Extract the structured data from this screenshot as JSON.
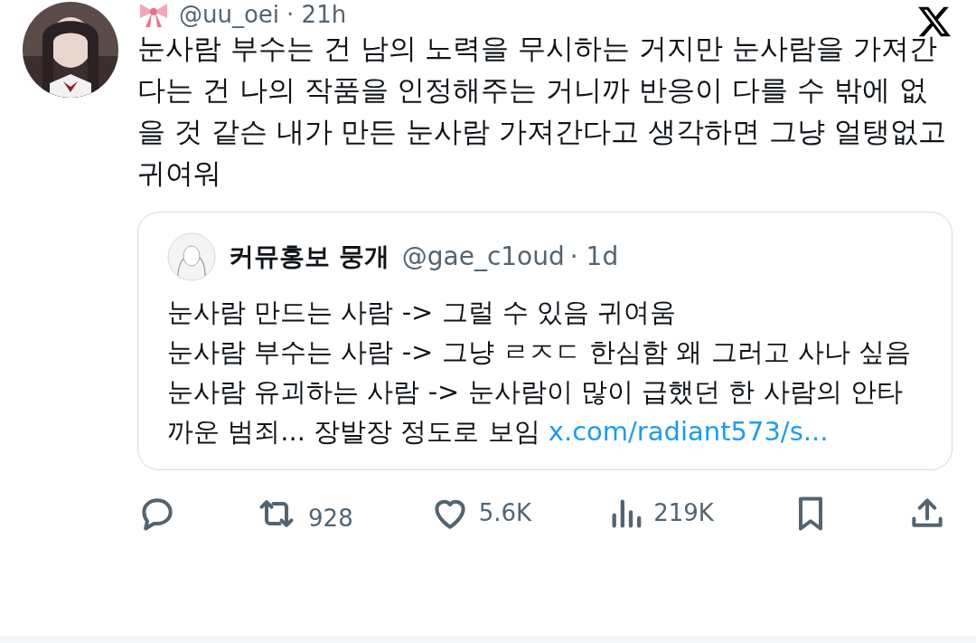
{
  "tweet": {
    "handle": "@uu_oei",
    "time": "· 21h",
    "text": "눈사람 부수는 건 남의 노력을 무시하는 거지만 눈사람을 가져간다는 건 나의 작품을 인정해주는 거니까 반응이 다를 수 밖에 없을 것 같슨 내가 만든 눈사람 가져간다고 생각하면 그냥 얼탱없고 귀여워"
  },
  "quote": {
    "name": "커뮤홍보 뭉개",
    "handle": "@gae_c1oud",
    "time": "· 1d",
    "lines": [
      "눈사람 만드는 사람 -> 그럴 수 있음 귀여움",
      "눈사람 부수는 사람 -> 그냥 ㄹㅈㄷ 한심함 왜 그러고 사나 싶음",
      "눈사람 유괴하는 사람 -> 눈사람이 많이 급했던 한 사람의 안타까운 범죄... 장발장 정도로 보임"
    ],
    "link": "x.com/radiant573/s..."
  },
  "actions": [
    {
      "kind": "reply"
    },
    {
      "kind": "repost",
      "count": "928"
    },
    {
      "kind": "like",
      "count": "5.6K"
    },
    {
      "kind": "views",
      "count": "219K"
    },
    {
      "kind": "bookmark"
    },
    {
      "kind": "share"
    }
  ]
}
